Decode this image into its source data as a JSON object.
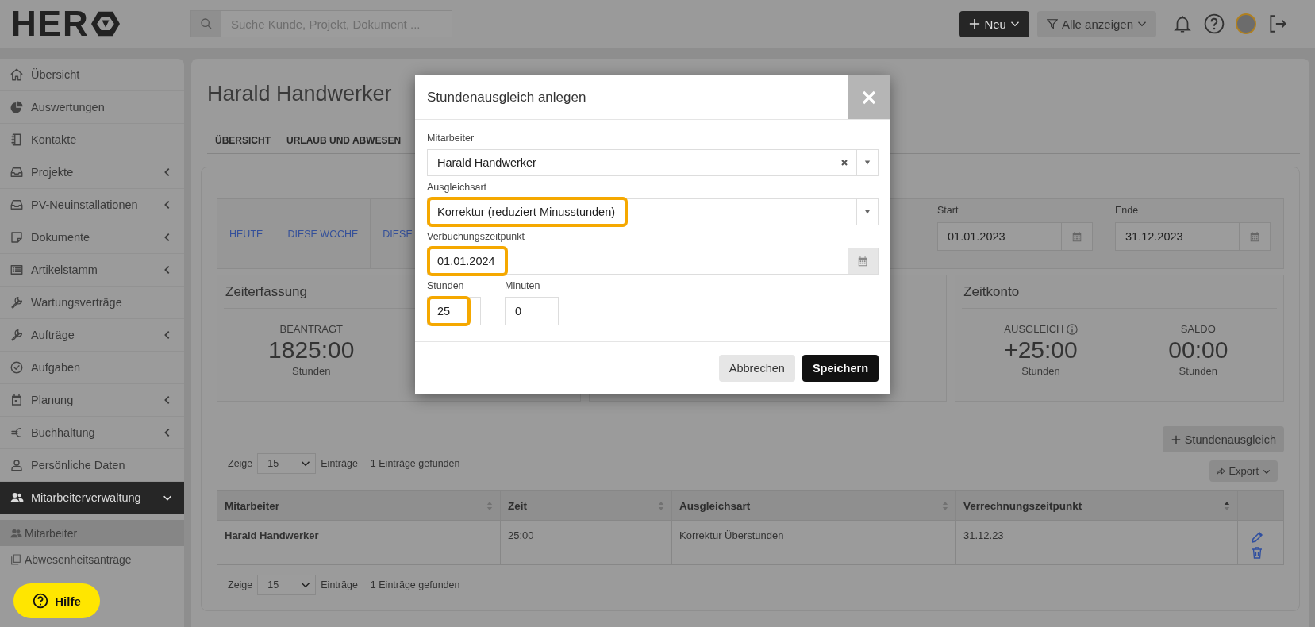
{
  "header": {
    "logo": "HER",
    "search": {
      "placeholder": "Suche Kunde, Projekt, Dokument ..."
    },
    "buttons": [
      {
        "label": "Neu",
        "kind": "primary"
      },
      {
        "label": "Alle anzeigen",
        "kind": "filter"
      }
    ]
  },
  "sidebar": {
    "items": [
      {
        "label": "Übersicht",
        "collapsible": false,
        "selected": false
      },
      {
        "label": "Auswertungen",
        "collapsible": false,
        "selected": false
      },
      {
        "label": "Kontakte",
        "collapsible": false,
        "selected": false
      },
      {
        "label": "Projekte",
        "collapsible": true,
        "expanded": false,
        "selected": false
      },
      {
        "label": "PV-Neuinstallationen",
        "collapsible": true,
        "expanded": false,
        "selected": false
      },
      {
        "label": "Dokumente",
        "collapsible": true,
        "expanded": false,
        "selected": false
      },
      {
        "label": "Artikelstamm",
        "collapsible": true,
        "expanded": false,
        "selected": false
      },
      {
        "label": "Wartungsverträge",
        "collapsible": false,
        "selected": false
      },
      {
        "label": "Aufträge",
        "collapsible": true,
        "expanded": false,
        "selected": false
      },
      {
        "label": "Aufgaben",
        "collapsible": false,
        "selected": false
      },
      {
        "label": "Planung",
        "collapsible": true,
        "expanded": false,
        "selected": false
      },
      {
        "label": "Buchhaltung",
        "collapsible": true,
        "expanded": false,
        "selected": false
      },
      {
        "label": "Persönliche Daten",
        "collapsible": false,
        "selected": false
      },
      {
        "label": "Mitarbeiterverwaltung",
        "collapsible": true,
        "expanded": true,
        "selected": true,
        "children": [
          {
            "label": "Mitarbeiter",
            "selected": true
          },
          {
            "label": "Abwesenheitsanträge",
            "selected": false
          }
        ]
      }
    ]
  },
  "page": {
    "title": "Harald Handwerker",
    "tabs": [
      {
        "label": "ÜBERSICHT"
      },
      {
        "label": "URLAUB UND ABWESEN"
      }
    ]
  },
  "period_filter": {
    "quick_links": [
      "HEUTE",
      "DIESE WOCHE",
      "DIESE"
    ],
    "start": {
      "label": "Start",
      "value": "01.01.2023"
    },
    "end": {
      "label": "Ende",
      "value": "31.12.2023"
    }
  },
  "stat_cards": [
    {
      "title": "Zeiterfassung",
      "stats": [
        {
          "label": "BEANTRAGT",
          "value": "1825:00",
          "unit": "Stunden"
        }
      ]
    },
    {
      "title": "Zeitkonto",
      "stats": [
        {
          "label": "AUSGLEICH",
          "info": true,
          "value": "+25:00",
          "unit": "Stunden"
        },
        {
          "label": "SALDO",
          "value": "00:00",
          "unit": "Stunden"
        }
      ]
    }
  ],
  "table_actions": {
    "add_button": "Stundenausgleich",
    "export_button": "Export"
  },
  "pagers": [
    {
      "show_label": "Zeige",
      "page_size": "15",
      "entries_label": "Einträge",
      "found": "1 Einträge gefunden"
    },
    {
      "show_label": "Zeige",
      "page_size": "15",
      "entries_label": "Einträge",
      "found": "1 Einträge gefunden"
    }
  ],
  "table": {
    "columns": [
      {
        "label": "Mitarbeiter",
        "sorted": false
      },
      {
        "label": "Zeit",
        "sorted": false
      },
      {
        "label": "Ausgleichsart",
        "sorted": false
      },
      {
        "label": "Verrechnungszeitpunkt",
        "sorted": true
      }
    ],
    "rows": [
      {
        "cells": [
          "Harald Handwerker",
          "25:00",
          "Korrektur Überstunden",
          "31.12.23"
        ]
      }
    ]
  },
  "modal": {
    "title": "Stundenausgleich anlegen",
    "fields": [
      {
        "kind": "select",
        "label": "Mitarbeiter",
        "value": "Harald Handwerker",
        "clearable": true,
        "highlighted": false
      },
      {
        "kind": "select",
        "label": "Ausgleichsart",
        "value": "Korrektur (reduziert Minusstunden)",
        "clearable": false,
        "highlighted": true
      },
      {
        "kind": "date",
        "label": "Verbuchungszeitpunkt",
        "value": "01.01.2024",
        "highlighted": true
      },
      {
        "kind": "number",
        "label": "Stunden",
        "value": "25",
        "highlighted": true
      },
      {
        "kind": "number",
        "label": "Minuten",
        "value": "0",
        "highlighted": false
      }
    ],
    "buttons": [
      {
        "label": "Abbrechen",
        "kind": "secondary"
      },
      {
        "label": "Speichern",
        "kind": "primary"
      }
    ]
  },
  "help_button": {
    "label": "Hilfe"
  }
}
